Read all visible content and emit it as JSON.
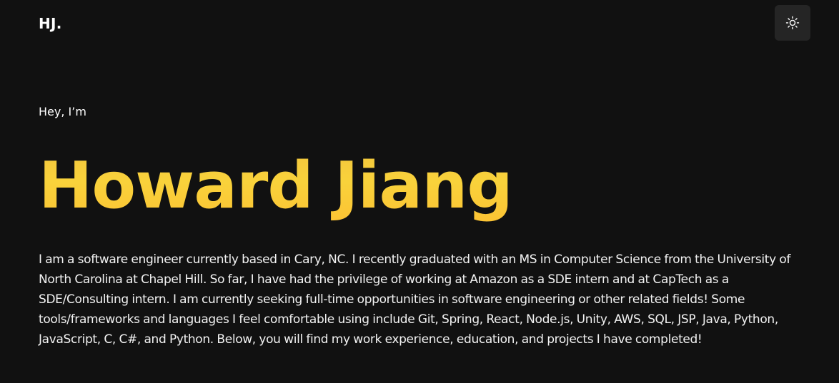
{
  "header": {
    "logo_text": "HJ.",
    "theme_toggle_icon": "sun-icon"
  },
  "hero": {
    "greeting": "Hey, I’m",
    "name": "Howard Jiang",
    "bio": "I am a software engineer currently based in Cary, NC. I recently graduated with an MS in Computer Science from the University of North Carolina at Chapel Hill. So far, I have had the privilege of working at Amazon as a SDE intern and at CapTech as a SDE/Consulting intern. I am currently seeking full-time opportunities in software engineering or other related fields! Some tools/frameworks and languages I feel comfortable using include Git, Spring, React, Node.js, Unity, AWS, SQL, JSP, Java, Python, JavaScript, C, C#, and Python. Below, you will find my work experience, education, and projects I have completed!"
  },
  "colors": {
    "background": "#111111",
    "accent": "#f6cc3b",
    "toggle_background": "#252525",
    "text": "#ffffff"
  }
}
